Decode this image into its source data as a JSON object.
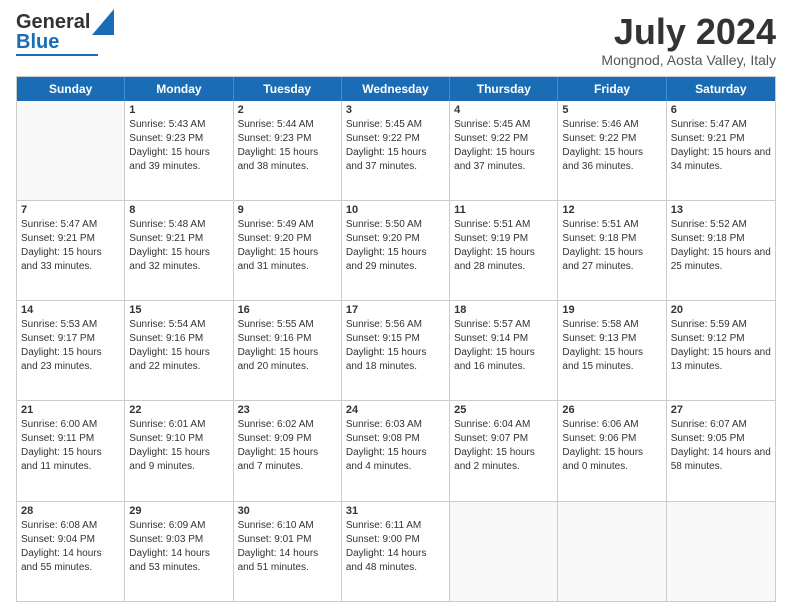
{
  "header": {
    "logo_general": "General",
    "logo_blue": "Blue",
    "month_title": "July 2024",
    "location": "Mongnod, Aosta Valley, Italy"
  },
  "weekdays": [
    "Sunday",
    "Monday",
    "Tuesday",
    "Wednesday",
    "Thursday",
    "Friday",
    "Saturday"
  ],
  "weeks": [
    [
      {
        "day": "",
        "empty": true
      },
      {
        "day": "1",
        "sunrise": "5:43 AM",
        "sunset": "9:23 PM",
        "daylight": "15 hours and 39 minutes."
      },
      {
        "day": "2",
        "sunrise": "5:44 AM",
        "sunset": "9:23 PM",
        "daylight": "15 hours and 38 minutes."
      },
      {
        "day": "3",
        "sunrise": "5:45 AM",
        "sunset": "9:22 PM",
        "daylight": "15 hours and 37 minutes."
      },
      {
        "day": "4",
        "sunrise": "5:45 AM",
        "sunset": "9:22 PM",
        "daylight": "15 hours and 37 minutes."
      },
      {
        "day": "5",
        "sunrise": "5:46 AM",
        "sunset": "9:22 PM",
        "daylight": "15 hours and 36 minutes."
      },
      {
        "day": "6",
        "sunrise": "5:47 AM",
        "sunset": "9:21 PM",
        "daylight": "15 hours and 34 minutes."
      }
    ],
    [
      {
        "day": "7",
        "sunrise": "5:47 AM",
        "sunset": "9:21 PM",
        "daylight": "15 hours and 33 minutes."
      },
      {
        "day": "8",
        "sunrise": "5:48 AM",
        "sunset": "9:21 PM",
        "daylight": "15 hours and 32 minutes."
      },
      {
        "day": "9",
        "sunrise": "5:49 AM",
        "sunset": "9:20 PM",
        "daylight": "15 hours and 31 minutes."
      },
      {
        "day": "10",
        "sunrise": "5:50 AM",
        "sunset": "9:20 PM",
        "daylight": "15 hours and 29 minutes."
      },
      {
        "day": "11",
        "sunrise": "5:51 AM",
        "sunset": "9:19 PM",
        "daylight": "15 hours and 28 minutes."
      },
      {
        "day": "12",
        "sunrise": "5:51 AM",
        "sunset": "9:18 PM",
        "daylight": "15 hours and 27 minutes."
      },
      {
        "day": "13",
        "sunrise": "5:52 AM",
        "sunset": "9:18 PM",
        "daylight": "15 hours and 25 minutes."
      }
    ],
    [
      {
        "day": "14",
        "sunrise": "5:53 AM",
        "sunset": "9:17 PM",
        "daylight": "15 hours and 23 minutes."
      },
      {
        "day": "15",
        "sunrise": "5:54 AM",
        "sunset": "9:16 PM",
        "daylight": "15 hours and 22 minutes."
      },
      {
        "day": "16",
        "sunrise": "5:55 AM",
        "sunset": "9:16 PM",
        "daylight": "15 hours and 20 minutes."
      },
      {
        "day": "17",
        "sunrise": "5:56 AM",
        "sunset": "9:15 PM",
        "daylight": "15 hours and 18 minutes."
      },
      {
        "day": "18",
        "sunrise": "5:57 AM",
        "sunset": "9:14 PM",
        "daylight": "15 hours and 16 minutes."
      },
      {
        "day": "19",
        "sunrise": "5:58 AM",
        "sunset": "9:13 PM",
        "daylight": "15 hours and 15 minutes."
      },
      {
        "day": "20",
        "sunrise": "5:59 AM",
        "sunset": "9:12 PM",
        "daylight": "15 hours and 13 minutes."
      }
    ],
    [
      {
        "day": "21",
        "sunrise": "6:00 AM",
        "sunset": "9:11 PM",
        "daylight": "15 hours and 11 minutes."
      },
      {
        "day": "22",
        "sunrise": "6:01 AM",
        "sunset": "9:10 PM",
        "daylight": "15 hours and 9 minutes."
      },
      {
        "day": "23",
        "sunrise": "6:02 AM",
        "sunset": "9:09 PM",
        "daylight": "15 hours and 7 minutes."
      },
      {
        "day": "24",
        "sunrise": "6:03 AM",
        "sunset": "9:08 PM",
        "daylight": "15 hours and 4 minutes."
      },
      {
        "day": "25",
        "sunrise": "6:04 AM",
        "sunset": "9:07 PM",
        "daylight": "15 hours and 2 minutes."
      },
      {
        "day": "26",
        "sunrise": "6:06 AM",
        "sunset": "9:06 PM",
        "daylight": "15 hours and 0 minutes."
      },
      {
        "day": "27",
        "sunrise": "6:07 AM",
        "sunset": "9:05 PM",
        "daylight": "14 hours and 58 minutes."
      }
    ],
    [
      {
        "day": "28",
        "sunrise": "6:08 AM",
        "sunset": "9:04 PM",
        "daylight": "14 hours and 55 minutes."
      },
      {
        "day": "29",
        "sunrise": "6:09 AM",
        "sunset": "9:03 PM",
        "daylight": "14 hours and 53 minutes."
      },
      {
        "day": "30",
        "sunrise": "6:10 AM",
        "sunset": "9:01 PM",
        "daylight": "14 hours and 51 minutes."
      },
      {
        "day": "31",
        "sunrise": "6:11 AM",
        "sunset": "9:00 PM",
        "daylight": "14 hours and 48 minutes."
      },
      {
        "day": "",
        "empty": true
      },
      {
        "day": "",
        "empty": true
      },
      {
        "day": "",
        "empty": true
      }
    ]
  ]
}
